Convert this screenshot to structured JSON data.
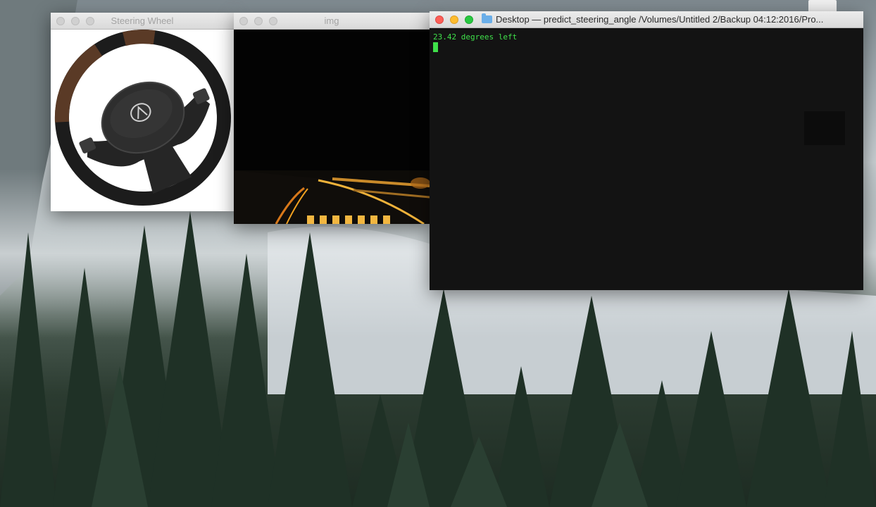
{
  "windows": {
    "wheel": {
      "title": "Steering Wheel",
      "brand_icon": "acura-logo-icon"
    },
    "img": {
      "title": "img"
    },
    "terminal": {
      "title": "Desktop — predict_steering_angle /Volumes/Untitled 2/Backup 04:12:2016/Pro...",
      "output_line": "23.42 degrees left"
    }
  },
  "colors": {
    "terminal_text": "#3fe04a",
    "terminal_bg": "#131313",
    "road_line": "#f0a020"
  }
}
